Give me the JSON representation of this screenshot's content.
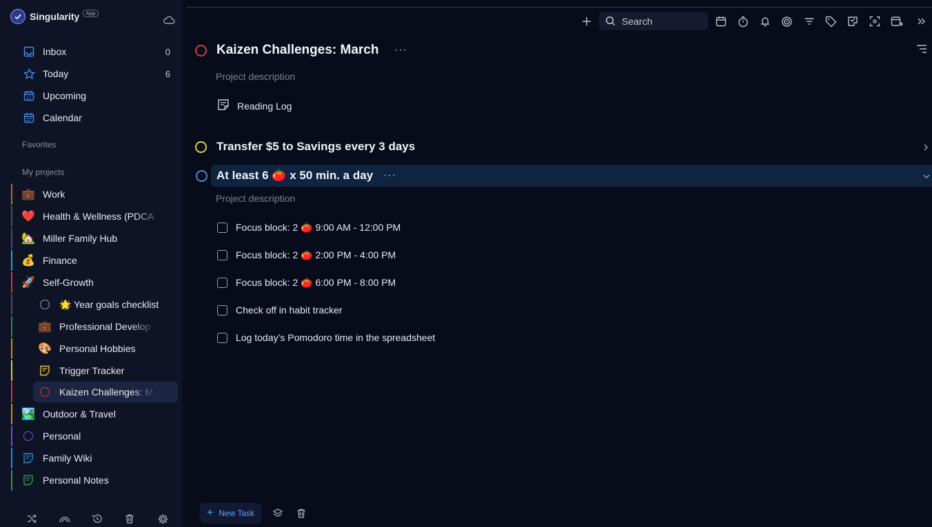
{
  "app": {
    "name": "Singularity",
    "badge": "App"
  },
  "nav": [
    {
      "label": "Inbox",
      "count": "0",
      "icon": "inbox-icon"
    },
    {
      "label": "Today",
      "count": "6",
      "icon": "star-icon"
    },
    {
      "label": "Upcoming",
      "count": "",
      "icon": "calendar-grid-icon"
    },
    {
      "label": "Calendar",
      "count": "",
      "icon": "calendar-icon"
    }
  ],
  "sections": {
    "favorites": "Favorites",
    "my_projects": "My projects"
  },
  "projects": [
    {
      "label": "Work",
      "emoji": "💼",
      "color": "#b06f2a"
    },
    {
      "label": "Health & Wellness (PDCA",
      "emoji": "❤️",
      "color": "#4a5068"
    },
    {
      "label": "Miller Family Hub",
      "emoji": "🏡",
      "color": "#4a5068"
    },
    {
      "label": "Finance",
      "emoji": "💰",
      "color": "#2aa6b8"
    },
    {
      "label": "Self-Growth",
      "emoji": "🚀",
      "color": "#d23a3a"
    },
    {
      "label": "🌟 Year goals checklist",
      "emoji": "",
      "color": "#4a5068"
    },
    {
      "label": "Professional Develop",
      "emoji": "💼",
      "color": "#2a8a5a"
    },
    {
      "label": "Personal Hobbies",
      "emoji": "🎨",
      "color": "#d08a2a"
    },
    {
      "label": "Trigger Tracker",
      "emoji": "",
      "color": "#e0c83a"
    },
    {
      "label": "Kaizen Challenges: M",
      "emoji": "",
      "color": "#d23a3a"
    },
    {
      "label": "Outdoor & Travel",
      "emoji": "🏞️",
      "color": "#d08a2a"
    },
    {
      "label": "Personal",
      "emoji": "",
      "color": "#7a4ad8"
    },
    {
      "label": "Family Wiki",
      "emoji": "",
      "color": "#2a8ad8"
    },
    {
      "label": "Personal Notes",
      "emoji": "",
      "color": "#2a9a4a"
    }
  ],
  "toolbar": {
    "search_placeholder": "Search",
    "icons": [
      "plus-icon",
      "search-icon",
      "calendar-icon",
      "timer-icon",
      "bell-icon",
      "target-icon",
      "filter-icon",
      "tag-icon",
      "habit-icon",
      "focus-icon",
      "add-window-icon",
      "collapse-icon"
    ]
  },
  "main": {
    "project": {
      "title": "Kaizen Challenges: March",
      "description": "Project description",
      "notes": [
        "Reading Log"
      ]
    },
    "groups": [
      {
        "title": "Transfer $5 to Savings every 3 days",
        "color": "#e0d23a"
      },
      {
        "title": "At least 6 🍅 x 50 min. a day",
        "color": "#4a8ad8",
        "description": "Project description",
        "tasks": [
          "Focus block: 2 🍅 9:00 AM - 12:00 PM",
          "Focus block: 2 🍅 2:00 PM - 4:00 PM",
          "Focus block: 2 🍅 6:00 PM - 8:00 PM",
          "Check off in habit tracker",
          "Log today’s Pomodoro time in the spreadsheet"
        ]
      }
    ],
    "new_task_label": "New Task",
    "more_label": "···"
  },
  "colors": {
    "accent": "#5aa0ff",
    "kaizen": "#d23a3a",
    "transfer": "#e0d23a",
    "pomodoro": "#4a8ad8"
  }
}
